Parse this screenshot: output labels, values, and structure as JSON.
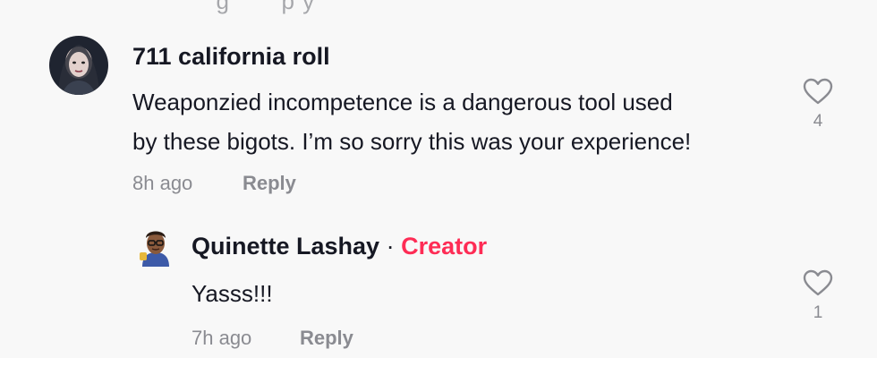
{
  "top_cut": {
    "text": "     g       p y"
  },
  "comments": [
    {
      "username": "711 california roll",
      "text_line1": "Weaponzied incompetence is a dangerous tool used",
      "text_line2": "by these bigots. I’m so sorry this was your experience!",
      "time": "8h ago",
      "reply_label": "Reply",
      "likes": "4",
      "avatar_icon": "user-avatar"
    }
  ],
  "reply": {
    "username": "Quinette Lashay",
    "separator": "·",
    "badge": "Creator",
    "text": "Yasss!!!",
    "time": "7h ago",
    "reply_label": "Reply",
    "likes": "1",
    "avatar_icon": "creator-avatar"
  },
  "colors": {
    "accent": "#fe2c55",
    "meta": "#8a8b91",
    "text": "#161823",
    "background": "#f8f8f8"
  }
}
